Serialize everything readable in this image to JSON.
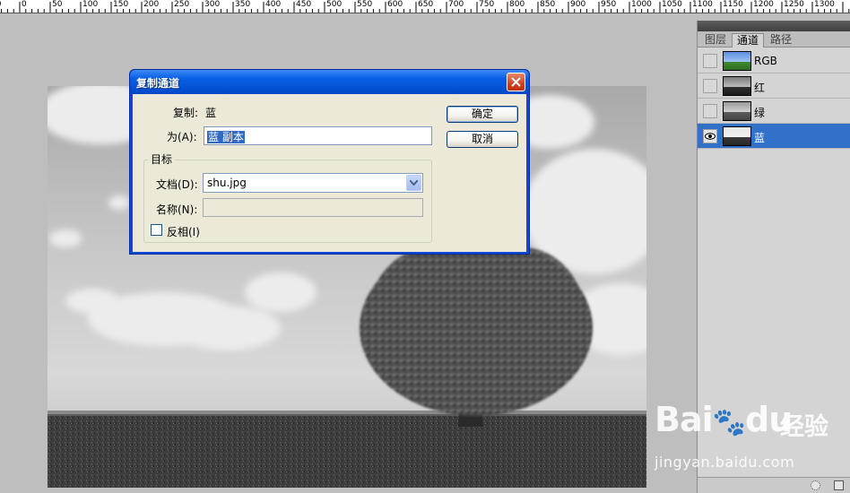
{
  "ruler": {
    "labels": [
      "50",
      "0",
      "50",
      "100",
      "150",
      "200",
      "250",
      "300",
      "350",
      "400",
      "450",
      "500",
      "550",
      "600",
      "650",
      "700",
      "750",
      "800",
      "850",
      "900",
      "950",
      "1000",
      "1050",
      "1100",
      "1150",
      "1200",
      "1250",
      "1300"
    ]
  },
  "dialog": {
    "title": "复制通道",
    "source_label": "复制:",
    "source_value": "蓝",
    "as_label": "为(A):",
    "as_value": "蓝 副本",
    "ok_label": "确定",
    "cancel_label": "取消",
    "group_label": "目标",
    "document_label": "文档(D):",
    "document_value": "shu.jpg",
    "name_label": "名称(N):",
    "name_value": "",
    "invert_label": "反相(I)",
    "invert_checked": false
  },
  "panel": {
    "tabs": [
      {
        "label": "图层",
        "active": false
      },
      {
        "label": "通道",
        "active": true
      },
      {
        "label": "路径",
        "active": false
      }
    ],
    "channels": [
      {
        "name": "RGB",
        "visible": false,
        "selected": false
      },
      {
        "name": "红",
        "visible": false,
        "selected": false
      },
      {
        "name": "绿",
        "visible": false,
        "selected": false
      },
      {
        "name": "蓝",
        "visible": true,
        "selected": true
      }
    ]
  },
  "watermark": {
    "logo": "Bai",
    "logo_tail": "du",
    "suffix": "经验",
    "url": "jingyan.baidu.com"
  },
  "colors": {
    "selection_blue": "#3171c9",
    "dialog_title_blue": "#0a5fe6",
    "close_red": "#d0431f"
  }
}
